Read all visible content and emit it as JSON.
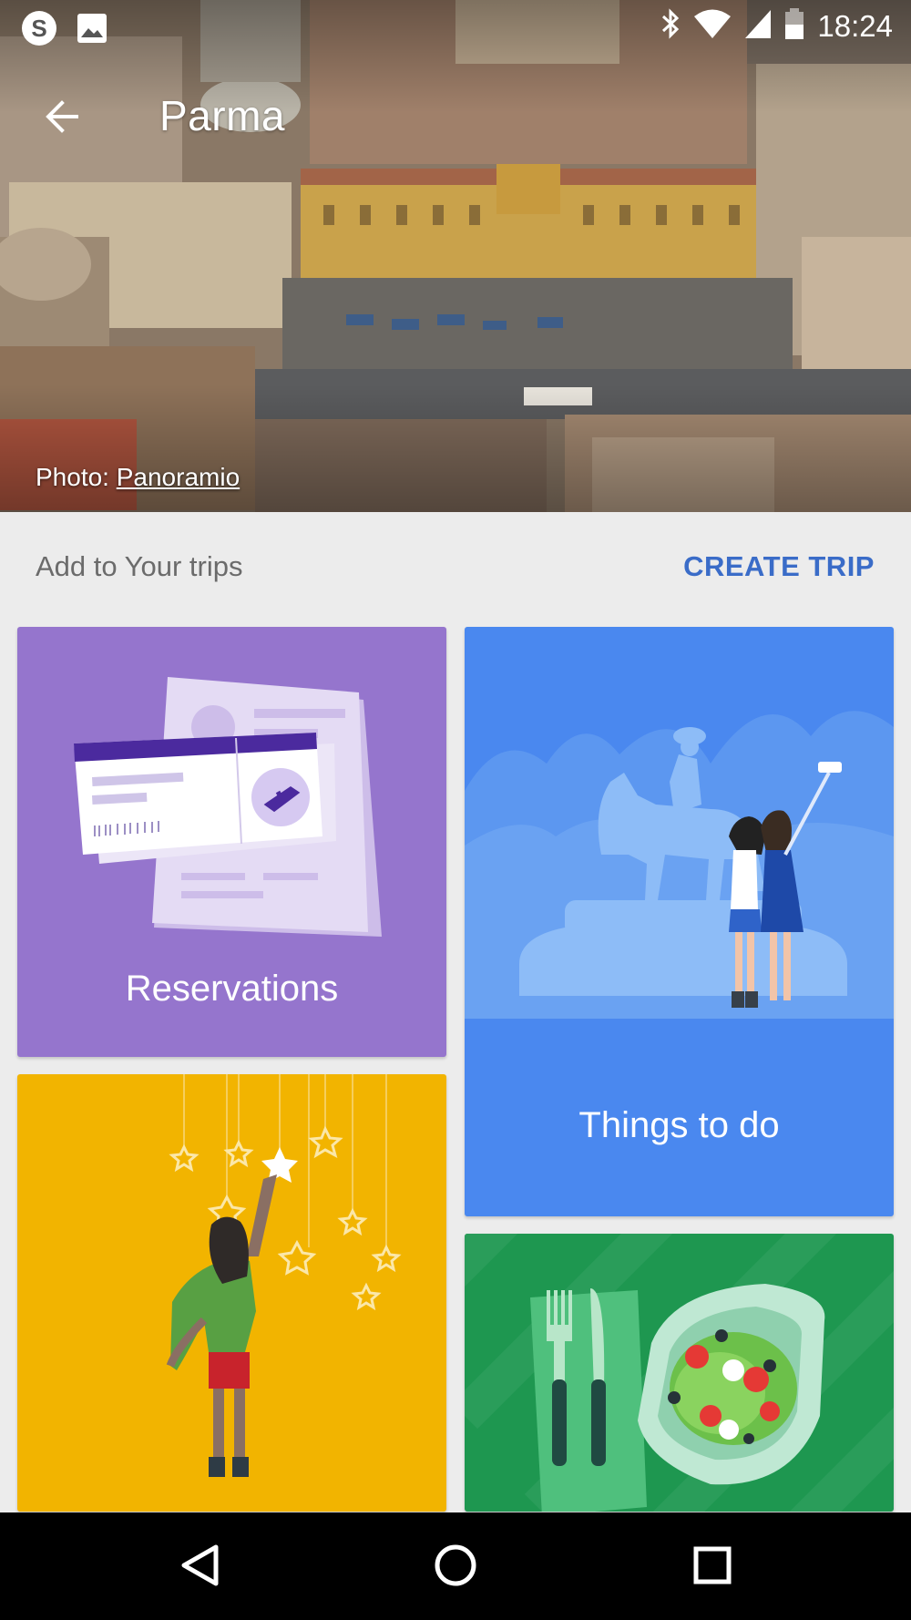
{
  "status_bar": {
    "time": "18:24",
    "icons": [
      "skype-icon",
      "image-icon",
      "bluetooth-icon",
      "wifi-icon",
      "signal-icon",
      "battery-icon"
    ]
  },
  "header": {
    "title": "Parma",
    "back_icon": "arrow-back-icon"
  },
  "photo_credit": {
    "prefix": "Photo: ",
    "source": "Panoramio"
  },
  "trips": {
    "label": "Add to Your trips",
    "create_label": "CREATE TRIP",
    "accent_color": "#3a6cc8"
  },
  "cards": [
    {
      "label": "Reservations",
      "color": "#9575cd"
    },
    {
      "label": "Things to do",
      "color": "#4a88ef"
    },
    {
      "label": "",
      "color": "#f2b400"
    },
    {
      "label": "",
      "color": "#1e9750"
    }
  ],
  "nav_bar": {
    "icons": [
      "back-triangle-icon",
      "home-circle-icon",
      "recents-square-icon"
    ]
  }
}
